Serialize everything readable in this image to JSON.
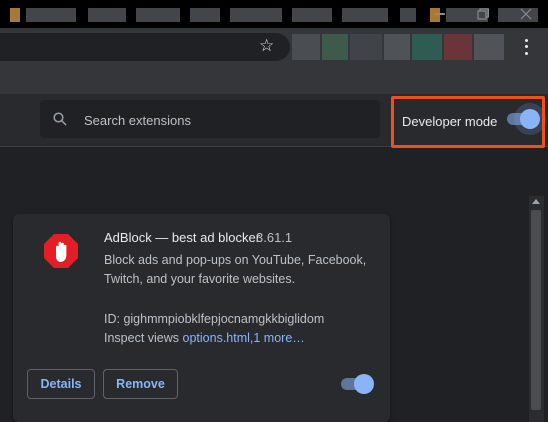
{
  "window": {
    "minimize_icon": "minimize-icon",
    "restore_icon": "restore-icon",
    "close_icon": "close-icon"
  },
  "toolbar": {
    "bookmark_icon": "star-icon",
    "menu_icon": "kebab-menu-icon"
  },
  "header": {
    "search": {
      "placeholder": "Search extensions"
    },
    "developer_mode": {
      "label": "Developer mode",
      "enabled": true,
      "highlight_color": "#f04e1b"
    }
  },
  "extension": {
    "name": "AdBlock — best ad blocker",
    "version": "3.61.1",
    "description": "Block ads and pop-ups on YouTube, Facebook, Twitch, and your favorite websites.",
    "id_line": "ID: gighmmpiobklfepjocnamgkkbiglidom",
    "inspect_label": "Inspect views",
    "inspect_link": "options.html,1 more…",
    "details_label": "Details",
    "remove_label": "Remove",
    "enabled": true,
    "logo_color": "#e21f26"
  },
  "colors": {
    "accent": "#8ab4f8",
    "background": "#202124",
    "card": "#292a2d"
  }
}
